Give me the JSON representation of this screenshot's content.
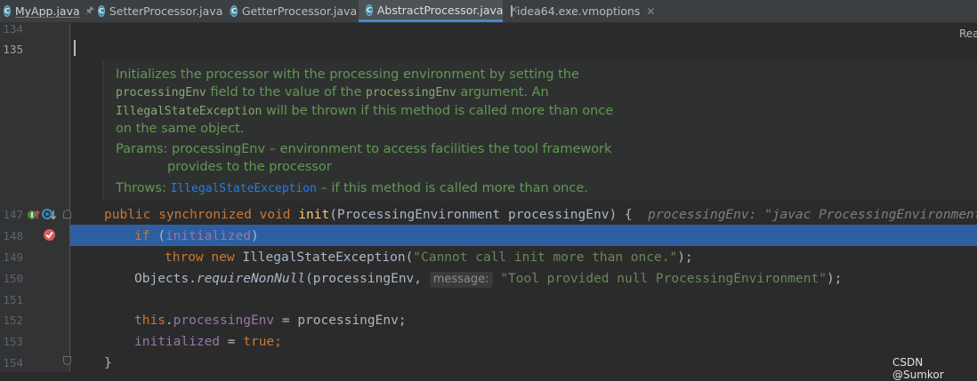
{
  "tabs": [
    {
      "label": "MyApp.java",
      "icon": "java-class-icon",
      "glyph": "C",
      "has_error": true,
      "pinned": true,
      "active": false
    },
    {
      "label": "SetterProcessor.java",
      "icon": "java-class-icon",
      "glyph": "C",
      "pinned": true,
      "active": false
    },
    {
      "label": "GetterProcessor.java",
      "icon": "java-class-icon",
      "glyph": "C",
      "pinned": true,
      "active": false
    },
    {
      "label": "AbstractProcessor.java",
      "icon": "java-class-icon",
      "glyph": "C",
      "active": true,
      "closable": true
    },
    {
      "label": "idea64.exe.vmoptions",
      "icon": "text-file-icon",
      "closable": true,
      "active": false
    }
  ],
  "reader_mode": "Rea",
  "doc": {
    "line1": "Initializes the processor with the processing environment by setting the",
    "line2_code1": "processingEnv",
    "line2_mid": " field to the value of the ",
    "line2_code2": "processingEnv",
    "line2_end": " argument. An",
    "line3_code": "IllegalStateException",
    "line3_end": " will be thrown if this method is called more than once",
    "line4": "on the same object.",
    "params_label": "Params: ",
    "params_text": "processingEnv – environment to access facilities the tool framework",
    "params_text2": "provides to the processor",
    "throws_label": "Throws: ",
    "throws_link": "IllegalStateException",
    "throws_text": " – if this method is called more than once."
  },
  "line_numbers": {
    "l134": "134",
    "l135": "135",
    "l147": "147",
    "l148": "148",
    "l149": "149",
    "l150": "150",
    "l151": "151",
    "l152": "152",
    "l153": "153",
    "l154": "154"
  },
  "code": {
    "l147": {
      "public": "public ",
      "synchronized": "synchronized ",
      "void": "void ",
      "name": "init",
      "params": "(ProcessingEnvironment processingEnv) {",
      "inlay": "processingEnv: \"javac ProcessingEnvironment\""
    },
    "l148": {
      "if": "if ",
      "open": "(",
      "field": "initialized",
      "close": ")"
    },
    "l149": {
      "throw": "throw ",
      "new": "new ",
      "rest": "IllegalStateException(",
      "str": "\"Cannot call init more than once.\"",
      "end": ");"
    },
    "l150": {
      "obj": "Objects.",
      "method": "requireNonNull",
      "args": "(processingEnv, ",
      "hint": "message:",
      "str": "\"Tool provided null ProcessingEnvironment\"",
      "end": ");"
    },
    "l152": {
      "this": "this",
      "dot": ".",
      "field": "processingEnv",
      "rest": " = processingEnv;"
    },
    "l153": {
      "field": "initialized",
      "eq": " = ",
      "val": "true",
      "end": ";"
    },
    "l154": {
      "brace": "}"
    }
  },
  "watermark": "CSDN @Sumkor",
  "colors": {
    "keyword": "#cc7832",
    "method": "#ffc66d",
    "field": "#9876aa",
    "string": "#6a8759",
    "doc": "#629755",
    "selection": "#2d5fa0",
    "link": "#287bde"
  }
}
